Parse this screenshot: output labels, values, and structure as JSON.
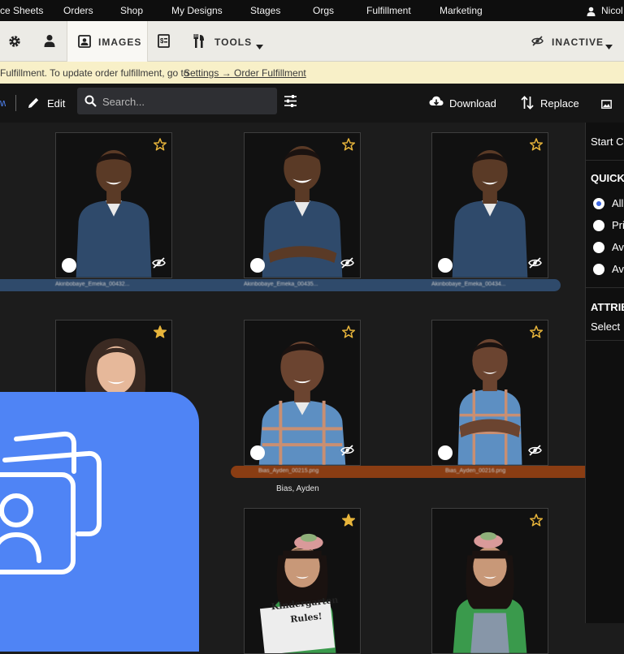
{
  "topnav": {
    "items": [
      "ce Sheets",
      "Orders",
      "Shop",
      "My Designs",
      "Stages",
      "Orgs",
      "Fulfillment",
      "Marketing"
    ],
    "user": "Nicol"
  },
  "toolbar": {
    "images_label": "IMAGES",
    "tools_label": "TOOLS",
    "inactive_label": "INACTIVE"
  },
  "banner": {
    "text": "Fulfillment. To update order fulfillment, go to ",
    "link": "Settings → Order Fulfillment"
  },
  "actions": {
    "edit": "Edit",
    "search_placeholder": "Search...",
    "download": "Download",
    "replace": "Replace"
  },
  "photos": [
    {
      "filename": "Akinbobaye_Emeka_00432...",
      "starred": false,
      "color": "#2f4a6b"
    },
    {
      "filename": "Akinbobaye_Emeka_00435...",
      "starred": false,
      "color": "#2f4a6b"
    },
    {
      "filename": "Akinbobaye_Emeka_00434...",
      "starred": false,
      "color": "#2f4a6b"
    },
    {
      "filename": "",
      "starred": true,
      "color": "#3b2a22"
    },
    {
      "filename": "Bias_Ayden_00215.png",
      "starred": false,
      "color": "#5d8fc2"
    },
    {
      "filename": "Bias_Ayden_00216.png",
      "starred": false,
      "color": "#5d8fc2"
    },
    {
      "filename": "",
      "starred": true,
      "color": "#3a9a4c"
    },
    {
      "filename": "",
      "starred": false,
      "color": "#3a9a4c"
    }
  ],
  "subject_name": "Bias, Ayden",
  "sign_text": "Kindergarten Rules!",
  "rpanel": {
    "start": "Start C",
    "quick": "QUICK",
    "options": [
      "All",
      "Pri",
      "Av",
      "Av"
    ],
    "attrib": "ATTRIB",
    "select": "Select"
  },
  "colors": {
    "accent_blue": "#4f84f5",
    "star_gold": "#e8b53b",
    "selected_blue": "#2f4a6b",
    "selected_orange": "#8a3d13"
  }
}
